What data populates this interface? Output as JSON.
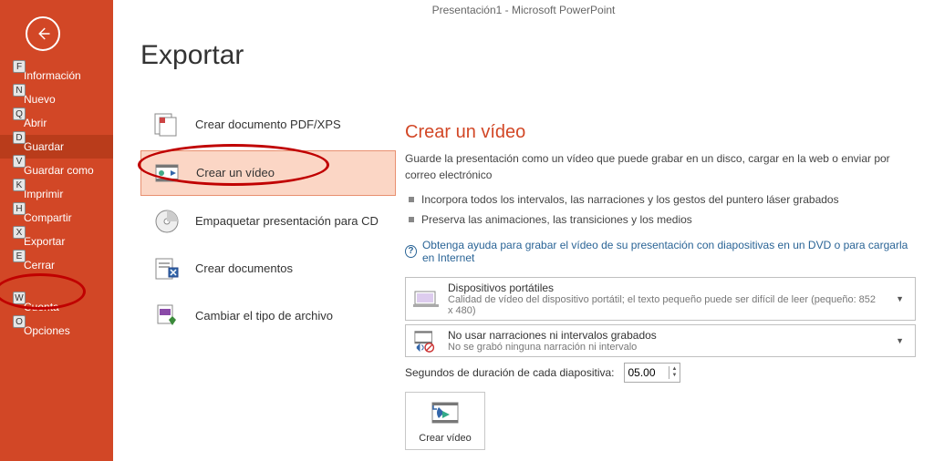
{
  "window": {
    "title": "Presentación1 - Microsoft PowerPoint"
  },
  "sidebar": {
    "items": [
      {
        "key": "F",
        "label": "Información"
      },
      {
        "key": "N",
        "label": "Nuevo"
      },
      {
        "key": "Q",
        "label": "Abrir"
      },
      {
        "key": "D",
        "label": "Guardar"
      },
      {
        "key": "V",
        "label": "Guardar como"
      },
      {
        "key": "K",
        "label": "Imprimir"
      },
      {
        "key": "H",
        "label": "Compartir"
      },
      {
        "key": "X",
        "label": "Exportar"
      },
      {
        "key": "E",
        "label": "Cerrar"
      },
      {
        "key": "W",
        "label": "Cuenta"
      },
      {
        "key": "O",
        "label": "Opciones"
      }
    ]
  },
  "page": {
    "title": "Exportar"
  },
  "exportOptions": [
    {
      "label": "Crear documento PDF/XPS"
    },
    {
      "label": "Crear un vídeo"
    },
    {
      "label": "Empaquetar presentación para CD"
    },
    {
      "label": "Crear documentos"
    },
    {
      "label": "Cambiar el tipo de archivo"
    }
  ],
  "rightPanel": {
    "title": "Crear un vídeo",
    "description": "Guarde la presentación como un vídeo que puede grabar en un disco, cargar en la web o enviar por correo electrónico",
    "bullets": [
      "Incorpora todos los intervalos, las narraciones y los gestos del puntero láser grabados",
      "Preserva las animaciones, las transiciones y los medios"
    ],
    "helpLink": "Obtenga ayuda para grabar el vídeo de su presentación con diapositivas en un DVD o para cargarla en Internet",
    "qualityDropdown": {
      "title": "Dispositivos portátiles",
      "subtitle": "Calidad de vídeo del dispositivo portátil; el texto pequeño puede ser difícil de leer (pequeño: 852 x 480)"
    },
    "narrationDropdown": {
      "title": "No usar narraciones ni intervalos grabados",
      "subtitle": "No se grabó ninguna narración ni intervalo"
    },
    "durationLabel": "Segundos de duración de cada diapositiva:",
    "durationValue": "05.00",
    "createButton": "Crear vídeo"
  }
}
